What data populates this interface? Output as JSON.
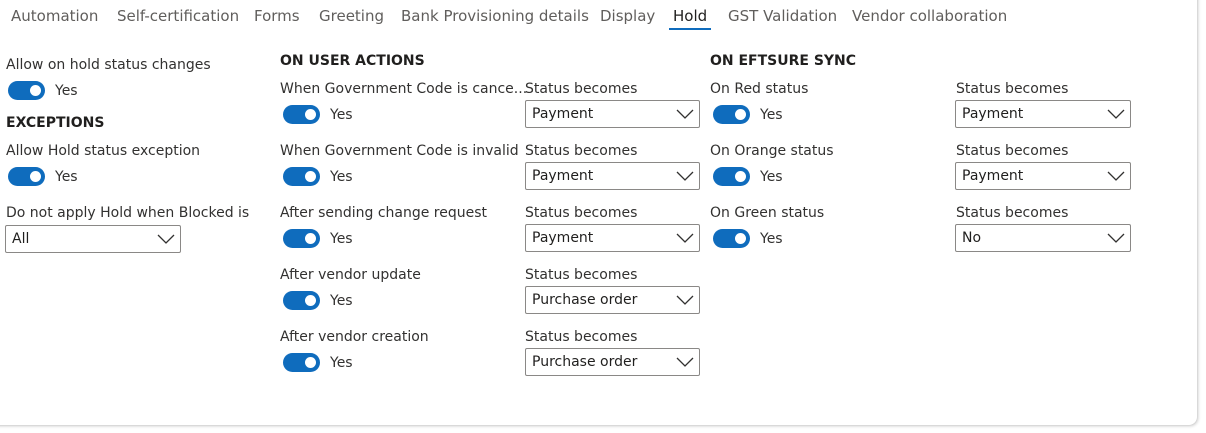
{
  "tabs": [
    "Automation",
    "Self-certification",
    "Forms",
    "Greeting",
    "Bank Provisioning details",
    "Display",
    "Hold",
    "GST Validation",
    "Vendor collaboration"
  ],
  "general": {
    "allow_changes_label": "Allow on hold status changes",
    "allow_changes_value": "Yes",
    "exceptions_heading": "EXCEPTIONS",
    "allow_exception_label": "Allow Hold status exception",
    "allow_exception_value": "Yes",
    "blocked_label": "Do not apply Hold when Blocked is",
    "blocked_value": "All"
  },
  "user_actions": {
    "heading": "ON USER ACTIONS",
    "rows": [
      {
        "label": "When Government Code is cance...",
        "toggle": "Yes",
        "status_label": "Status becomes",
        "status": "Payment"
      },
      {
        "label": "When Government Code is invalid",
        "toggle": "Yes",
        "status_label": "Status becomes",
        "status": "Payment"
      },
      {
        "label": "After sending change request",
        "toggle": "Yes",
        "status_label": "Status becomes",
        "status": "Payment"
      },
      {
        "label": "After vendor update",
        "toggle": "Yes",
        "status_label": "Status becomes",
        "status": "Purchase order"
      },
      {
        "label": "After vendor creation",
        "toggle": "Yes",
        "status_label": "Status becomes",
        "status": "Purchase order"
      }
    ]
  },
  "eftsure": {
    "heading": "ON EFTSURE SYNC",
    "rows": [
      {
        "label": "On Red status",
        "toggle": "Yes",
        "status_label": "Status becomes",
        "status": "Payment"
      },
      {
        "label": "On Orange status",
        "toggle": "Yes",
        "status_label": "Status becomes",
        "status": "Payment"
      },
      {
        "label": "On Green status",
        "toggle": "Yes",
        "status_label": "Status becomes",
        "status": "No"
      }
    ]
  },
  "colors": {
    "accent": "#0f6cbd",
    "text": "#323130",
    "border": "#8a8886"
  },
  "icons": {
    "dropdown": "chevron-down-icon"
  }
}
